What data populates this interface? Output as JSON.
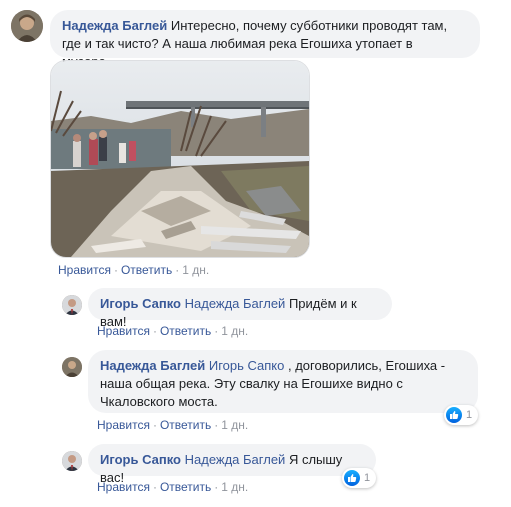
{
  "comments": [
    {
      "author": "Надежда Баглей",
      "text": "Интересно, почему субботники проводят там, где и так чисто? А наша любимая река Егошиха утопает в мусоре...",
      "actions": {
        "like": "Нравится",
        "reply": "Ответить",
        "time": "1 дн."
      },
      "photo_icon": "garbage-dump-photo"
    },
    {
      "author": "Игорь Сапко",
      "mention": "Надежда Баглей",
      "text": "Придём и к вам!",
      "actions": {
        "like": "Нравится",
        "reply": "Ответить",
        "time": "1 дн."
      }
    },
    {
      "author": "Надежда Баглей",
      "mention": "Игорь Сапко",
      "text": ", договорились, Егошиха - наша общая река. Эту свалку на Егошихе видно с Чкаловского моста.",
      "actions": {
        "like": "Нравится",
        "reply": "Ответить",
        "time": "1 дн."
      },
      "reactions": {
        "icon": "like-icon",
        "count": "1"
      }
    },
    {
      "author": "Игорь Сапко",
      "mention": "Надежда Баглей",
      "text": "Я слышу вас!",
      "actions": {
        "like": "Нравится",
        "reply": "Ответить",
        "time": "1 дн."
      },
      "reactions": {
        "icon": "like-icon",
        "count": "1"
      }
    }
  ],
  "colors": {
    "link": "#385898",
    "bubble": "#f2f3f5",
    "meta": "#90949c",
    "like_blue": "#0062df"
  }
}
